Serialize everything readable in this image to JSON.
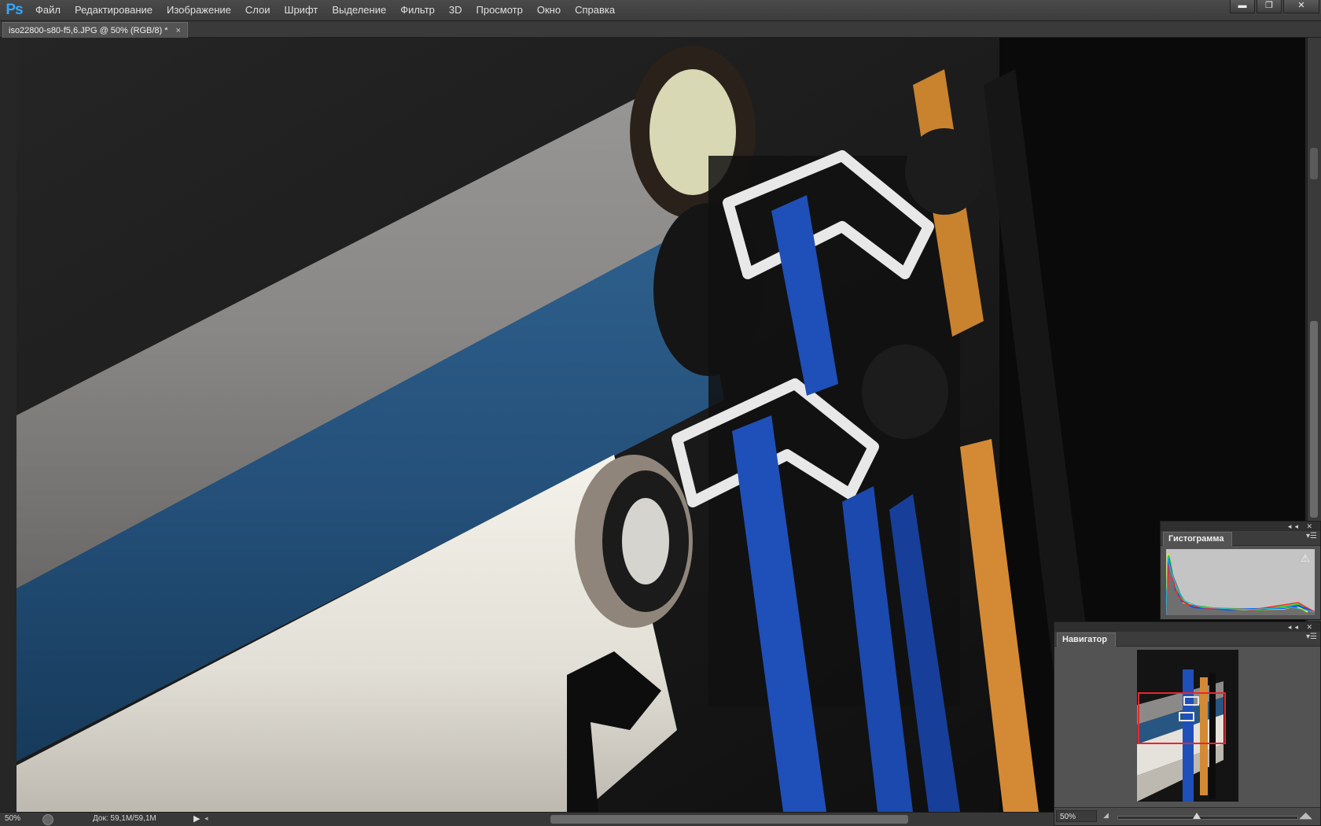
{
  "app": {
    "logo": "Ps",
    "menu": [
      "Файл",
      "Редактирование",
      "Изображение",
      "Слои",
      "Шрифт",
      "Выделение",
      "Фильтр",
      "3D",
      "Просмотр",
      "Окно",
      "Справка"
    ],
    "window_controls": {
      "minimize": "▬",
      "restore": "❐",
      "close": "✕"
    }
  },
  "document": {
    "tab_title": "iso22800-s80-f5,6.JPG @ 50% (RGB/8) *",
    "tab_close": "×"
  },
  "status": {
    "zoom": "50%",
    "doc_size": "Док: 59,1M/59,1M",
    "arrow": "▶",
    "scroll_left": "◂"
  },
  "histogram_panel": {
    "strip_icons": "◂◂ ✕",
    "tab": "Гистограмма",
    "menu_icon": "▾☰",
    "warning_icon": "⚠"
  },
  "navigator_panel": {
    "strip_icons": "◂◂ ✕",
    "tab": "Навигатор",
    "menu_icon": "▾☰",
    "zoom": "50%",
    "zoom_out_icon": "◢",
    "zoom_in_icon": "◢◣",
    "view_rect_color": "#e8262f"
  },
  "colors": {
    "ps_blue": "#31a8ff",
    "panel_bg": "#535353",
    "chrome_dark": "#282828"
  }
}
